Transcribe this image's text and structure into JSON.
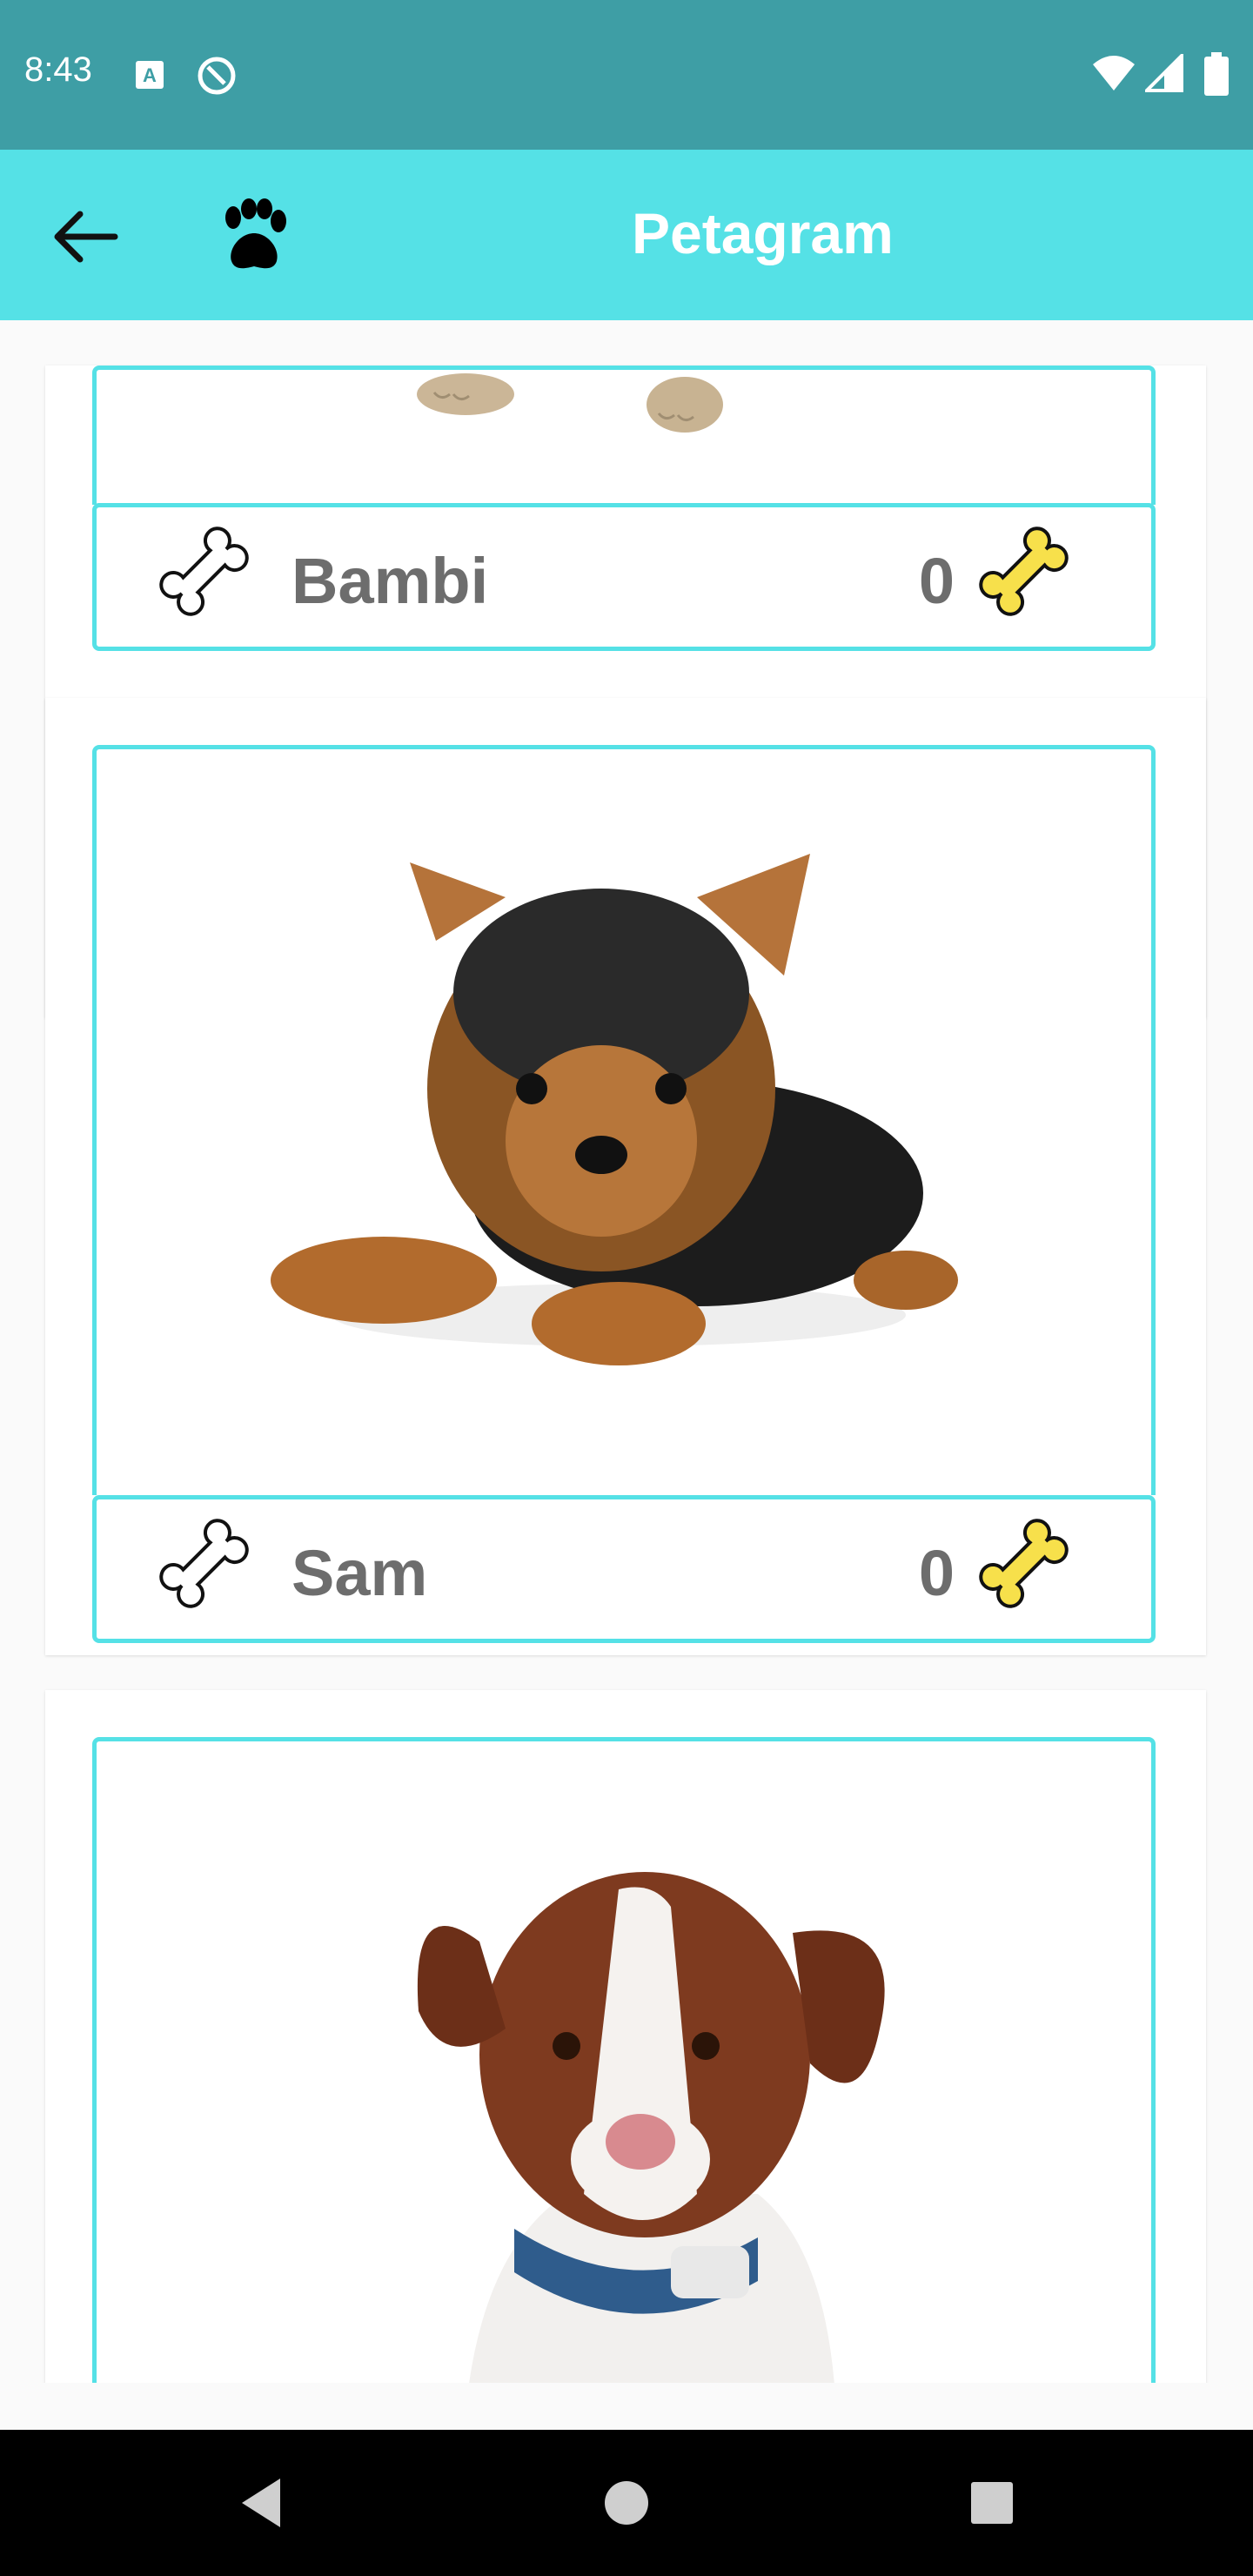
{
  "status_bar": {
    "time": "8:43",
    "icons": [
      "a-icon",
      "sync-icon",
      "wifi-icon",
      "signal-icon",
      "battery-icon"
    ]
  },
  "app_bar": {
    "title": "Petagram",
    "back_icon": "arrow-back-icon",
    "logo_icon": "paw-icon"
  },
  "pets": [
    {
      "name": "Bambi",
      "rating": "0"
    },
    {
      "name": "Sam",
      "rating": "0"
    },
    {
      "name": "",
      "rating": ""
    }
  ],
  "nav_bar": {
    "buttons": [
      "back-triangle-icon",
      "home-circle-icon",
      "recents-square-icon"
    ]
  },
  "colors": {
    "status_bar": "#3e9ea5",
    "app_bar": "#55e1e6",
    "card_border": "#55e1e6",
    "text_gray": "#6d6d6d",
    "bone_yellow": "#f7e04b"
  }
}
